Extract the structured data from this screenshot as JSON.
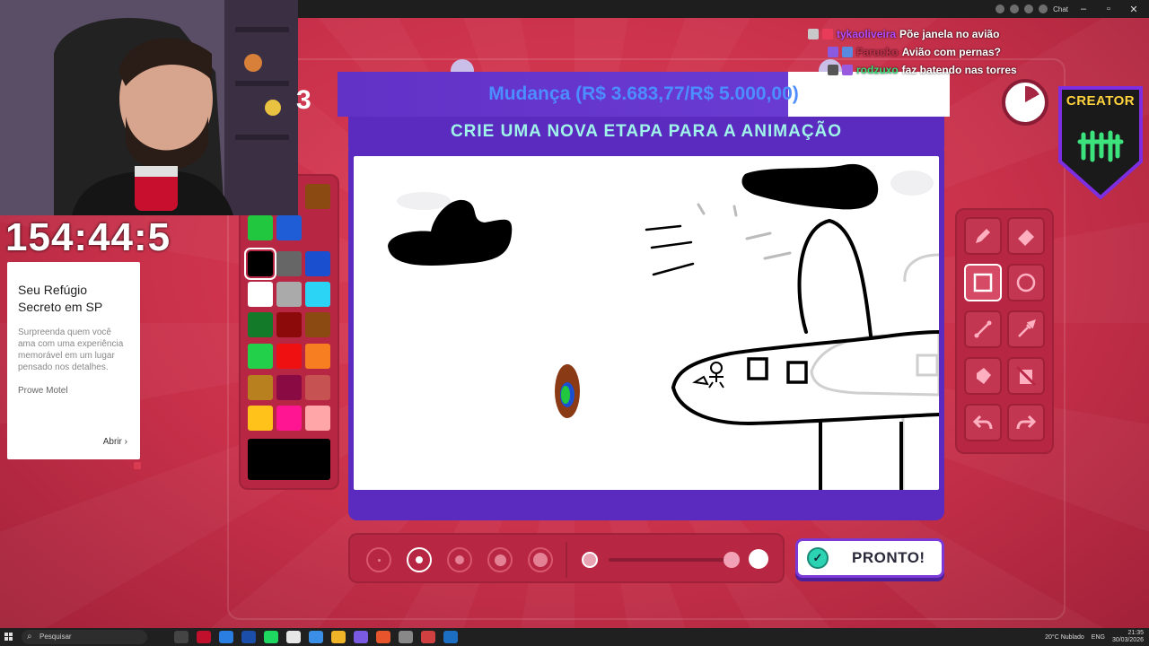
{
  "browser": {
    "chat_button_label": "Chat",
    "window_controls": [
      "–",
      "▫",
      "✕"
    ]
  },
  "chat": {
    "messages": [
      {
        "user": "tykaoliveira",
        "user_color": "#b44cff",
        "text": "Põe janela no avião"
      },
      {
        "user": "Farucko",
        "user_color": "#c0304a",
        "text": "Avião com pernas?"
      },
      {
        "user": "rodzuxo",
        "user_color": "#39e07a",
        "text": "faz batendo nas torres"
      }
    ]
  },
  "webcam": {
    "side_number": "3"
  },
  "stream_timer": "154:44:5",
  "ad": {
    "title": "Seu Refúgio Secreto em SP",
    "body": "Surpreenda quem você ama com uma experiência memorável em um lugar pensado nos detalhes.",
    "brand": "Prowe Motel",
    "link": "Abrir"
  },
  "game": {
    "banner_text": "Mudança (R$ 3.683,77/R$ 5.000,00)",
    "banner_progress": 0.7367,
    "instruction": "CRIE UMA NOVA ETAPA PARA A ANIMAÇÃO",
    "creator_label": "CREATOR",
    "done_label": "PRONTO!",
    "timer_elapsed_fraction": 0.17,
    "palette": [
      "#22c740",
      "#1e5dd6",
      "#000000",
      "#666666",
      "#1a4fd0",
      "#ffffff",
      "#aaaaaa",
      "#2bd3f5",
      "#137a2a",
      "#8c0a0a",
      "#8a4a12",
      "#22d04a",
      "#ef1111",
      "#f77f22",
      "#b8801f",
      "#8a0a44",
      "#c75252",
      "#ffc21a",
      "#ff1491",
      "#ffa7a8"
    ],
    "selected_color": "#000000",
    "tools": [
      "pencil-icon",
      "eraser-icon",
      "rectangle-icon",
      "ellipse-icon",
      "line-icon",
      "eyedropper-icon",
      "fill-icon",
      "clear-icon",
      "undo-icon",
      "redo-icon"
    ],
    "selected_tool": "rectangle-icon",
    "brush_sizes": 5,
    "selected_brush_size": 2
  },
  "taskbar": {
    "search_placeholder": "Pesquisar",
    "weather": "20°C  Nublado",
    "lang": "ENG",
    "time": "21:35",
    "date": "30/03/2026"
  }
}
